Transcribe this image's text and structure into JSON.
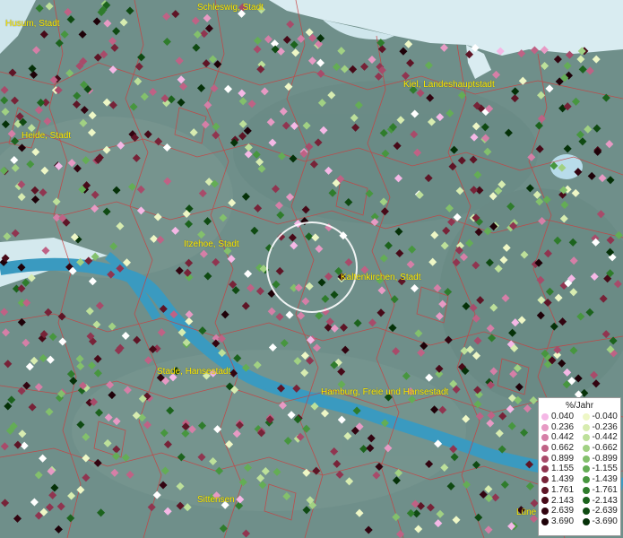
{
  "cities": [
    {
      "name": "Husum, Stadt"
    },
    {
      "name": "Schleswig, Stadt"
    },
    {
      "name": "Kiel, Landeshauptstadt"
    },
    {
      "name": "Heide, Stadt"
    },
    {
      "name": "Itzehoe, Stadt"
    },
    {
      "name": "Kaltenkirchen, Stadt"
    },
    {
      "name": "Stade, Hansestadt"
    },
    {
      "name": "Hamburg, Freie und Hansestadt"
    },
    {
      "name": "Sittensen"
    },
    {
      "name": "Lüne"
    }
  ],
  "legend": {
    "title": "%/Jahr",
    "positive": [
      {
        "label": "0.040",
        "color": "#f5b8e6"
      },
      {
        "label": "0.236",
        "color": "#e79ac4"
      },
      {
        "label": "0.442",
        "color": "#d57fa7"
      },
      {
        "label": "0.662",
        "color": "#bf6285"
      },
      {
        "label": "0.899",
        "color": "#a84b6a"
      },
      {
        "label": "1.155",
        "color": "#903550"
      },
      {
        "label": "1.439",
        "color": "#772338"
      },
      {
        "label": "1.761",
        "color": "#5e1526"
      },
      {
        "label": "2.143",
        "color": "#470a18"
      },
      {
        "label": "2.639",
        "color": "#320410"
      },
      {
        "label": "3.690",
        "color": "#1e0108"
      }
    ],
    "negative": [
      {
        "label": "-0.040",
        "color": "#eef7c6"
      },
      {
        "label": "-0.236",
        "color": "#d7ecb0"
      },
      {
        "label": "-0.442",
        "color": "#bde09a"
      },
      {
        "label": "-0.662",
        "color": "#a1d183"
      },
      {
        "label": "-0.899",
        "color": "#83c06c"
      },
      {
        "label": "-1.155",
        "color": "#64ad55"
      },
      {
        "label": "-1.439",
        "color": "#47963f"
      },
      {
        "label": "-1.761",
        "color": "#2f7c2c"
      },
      {
        "label": "-2.143",
        "color": "#1c631d"
      },
      {
        "label": "-2.639",
        "color": "#0f4a12"
      },
      {
        "label": "-3.690",
        "color": "#053108"
      }
    ]
  },
  "colors": {
    "land": "#6f8f8a",
    "water": "#3a9ac0",
    "sea": "#d9ecf1",
    "borders": "#c94040",
    "label": "#ffee00",
    "focus_ring": "#ffffff"
  }
}
